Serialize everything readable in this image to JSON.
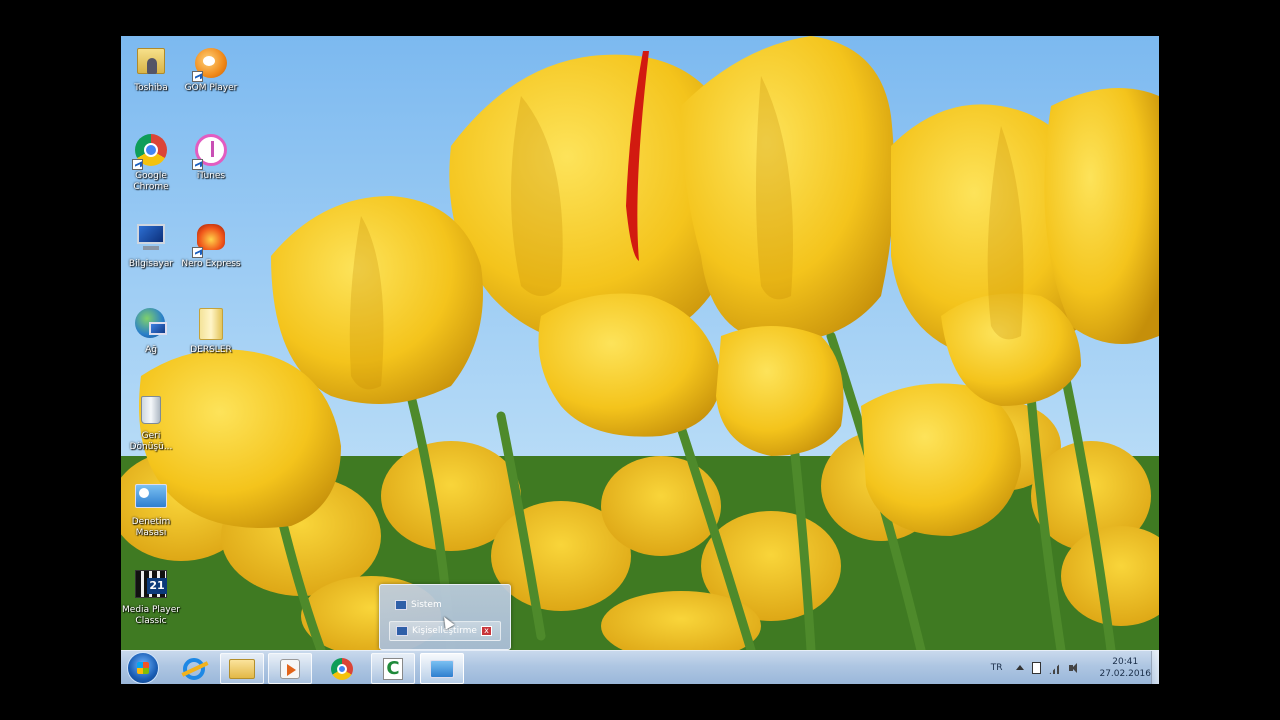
{
  "desktop": {
    "icons": [
      {
        "label": "Toshiba",
        "icon": "folder-user-icon"
      },
      {
        "label": "GOM Player",
        "icon": "gom-player-icon"
      },
      {
        "label": "Google Chrome",
        "icon": "chrome-icon"
      },
      {
        "label": "iTunes",
        "icon": "itunes-icon"
      },
      {
        "label": "Bilgisayar",
        "icon": "computer-icon"
      },
      {
        "label": "Nero Express",
        "icon": "nero-icon"
      },
      {
        "label": "Ağ",
        "icon": "network-icon"
      },
      {
        "label": "DERSLER",
        "icon": "folder-icon"
      },
      {
        "label": "Geri Dönüşü...",
        "icon": "recycle-bin-icon"
      },
      {
        "label": "Denetim Masası",
        "icon": "control-panel-icon"
      },
      {
        "label": "Media Player Classic",
        "icon": "media-player-classic-icon"
      }
    ]
  },
  "popup": {
    "items": [
      {
        "label": "Sistem"
      },
      {
        "label": "Kişiselleştirme"
      }
    ],
    "close_label": "x"
  },
  "taskbar": {
    "buttons": [
      {
        "icon": "internet-explorer-icon"
      },
      {
        "icon": "file-explorer-icon"
      },
      {
        "icon": "media-player-icon"
      },
      {
        "icon": "chrome-icon"
      },
      {
        "icon": "camtasia-icon"
      },
      {
        "icon": "control-panel-icon"
      }
    ],
    "tray": {
      "language": "TR",
      "time": "20:41",
      "date": "27.02.2016"
    }
  },
  "colors": {
    "sky": "#8cc4f2",
    "tulip": "#f2c21a",
    "taskbar": "#aec6e2"
  }
}
